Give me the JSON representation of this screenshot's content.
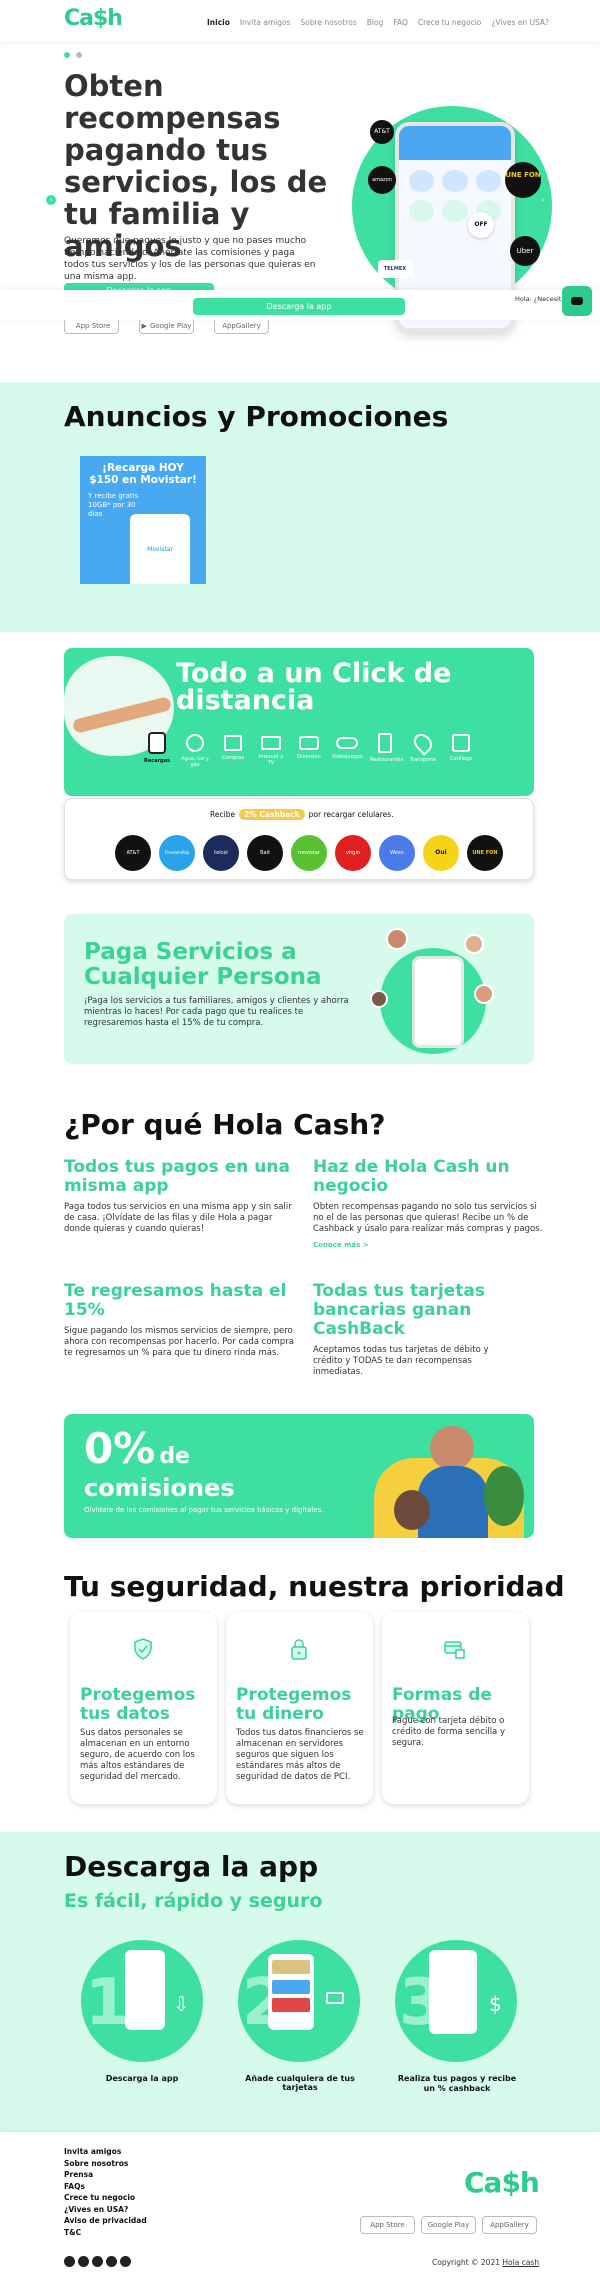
{
  "header": {
    "logo": "Ca$h",
    "nav": [
      "Inicio",
      "Invita amigos",
      "Sobre nosotros",
      "Blog",
      "FAQ",
      "Crece tu negocio",
      "¿Vives en USA?"
    ]
  },
  "hero": {
    "title": "Obten recompensas pagando tus servicios, los de tu familia y amigos",
    "desc": "Queremos que pagues lo justo y que no pases mucho tiempo haciéndolo. Ahórrate las comisiones y paga todos tus servicios y los de las personas que quieras en una misma app.",
    "cta": "Descarga la app",
    "stores": [
      "App Store",
      "Google Play",
      "AppGallery"
    ],
    "brands": [
      "AT&T",
      "UNE FON",
      "Uber",
      "amazon",
      "OFF",
      "TELMEX"
    ]
  },
  "sticky": {
    "cta": "Descarga la app",
    "help": "Hola. ¿Necesita ayuda?"
  },
  "promos": {
    "title": "Anuncios y Promociones",
    "card_title": "¡Recarga HOY $150 en Movistar!",
    "card_sub": "Y recibe gratis 10GB* por 30 días",
    "card_brand": "Movistar"
  },
  "click": {
    "title": "Todo a un Click de distancia",
    "categories": [
      "Recargas",
      "Agua, luz y gas",
      "Compras",
      "Internet y TV",
      "Diversión",
      "Videojuegos",
      "Restaurantes",
      "Transporte",
      "Catálogo"
    ],
    "cashback_pre": "Recibe",
    "cashback_badge": "2% Cashback",
    "cashback_post": "por recargar celulares.",
    "carriers": [
      "AT&T",
      "FreedomPop",
      "telcel",
      "Bait",
      "movistar",
      "virgin",
      "Weex",
      "Oui",
      "UNE FON"
    ]
  },
  "paga": {
    "title": "Paga Servicios a Cualquier Persona",
    "desc": "¡Paga los servicios a tus familiares, amigos y clientes y ahorra mientras lo haces! Por cada pago que tu realices te regresaremos hasta el 15% de tu compra."
  },
  "why": {
    "title": "¿Por qué Hola Cash?",
    "items": [
      {
        "title": "Todos tus pagos en una misma app",
        "desc": "Paga todos tus servicios en una misma app y sin salir de casa. ¡Olvídate de las filas y dile Hola a pagar donde quieras y cuando quieras!",
        "link": ""
      },
      {
        "title": "Haz de Hola Cash un negocio",
        "desc": "Obten recompensas pagando no solo tus servicios si no el de las personas que quieras! Recibe un % de Cashback y úsalo para realizar más compras y pagos.",
        "link": "Conoce más >"
      },
      {
        "title": "Te regresamos hasta el 15%",
        "desc": "Sigue pagando los mismos servicios de siempre, pero ahora con recompensas por hacerlo. Por cada compra te regresamos un % para que tu dinero rinda más.",
        "link": ""
      },
      {
        "title": "Todas tus tarjetas bancarias ganan CashBack",
        "desc": "Aceptamos todas tus tarjetas de débito y crédito y TODAS te dan recompensas inmediatas.",
        "link": ""
      }
    ]
  },
  "zero": {
    "big": "0%",
    "de": "de",
    "word": "comisiones",
    "desc": "Olvídate de las comisiones al pagar tus servicios básicos y digitales."
  },
  "security": {
    "title": "Tu seguridad, nuestra prioridad",
    "cards": [
      {
        "icon": "shield-icon",
        "title": "Protegemos tus datos",
        "desc": "Sus datos personales se almacenan en un entorno seguro, de acuerdo con los más altos estándares de seguridad del mercado."
      },
      {
        "icon": "lock-icon",
        "title": "Protegemos tu dinero",
        "desc": "Todos tus datos financieros se almacenan en servidores seguros que siguen los estándares más altos de seguridad de datos de PCI."
      },
      {
        "icon": "card-payment-icon",
        "title": "Formas de pago",
        "desc": "Pague con tarjeta débito o crédito de forma sencilla y segura."
      }
    ]
  },
  "download": {
    "title": "Descarga la app",
    "subtitle": "Es fácil, rápido y seguro",
    "steps": [
      {
        "num": "1",
        "label": "Descarga la app"
      },
      {
        "num": "2",
        "label": "Añade cualquiera de tus tarjetas"
      },
      {
        "num": "3",
        "label": "Realiza tus pagos y recibe un % cashback"
      }
    ]
  },
  "footer": {
    "links": [
      "Invita amigos",
      "Sobre nosotros",
      "Prensa",
      "FAQs",
      "Crece tu negocio",
      "¿Vives en USA?",
      "Aviso de privacidad",
      "T&C"
    ],
    "logo": "Ca$h",
    "stores": [
      "App Store",
      "Google Play",
      "AppGallery"
    ],
    "copyright": "Copyright © 2021",
    "copyright_link": "Hola cash",
    "social": [
      "instagram-icon",
      "facebook-icon",
      "twitter-icon",
      "youtube-icon",
      "linkedin-icon"
    ]
  },
  "colors": {
    "accent": "#3ee0a2",
    "dark_green": "#2ccb8e",
    "mint": "#d6fbec",
    "text": "#111111"
  }
}
